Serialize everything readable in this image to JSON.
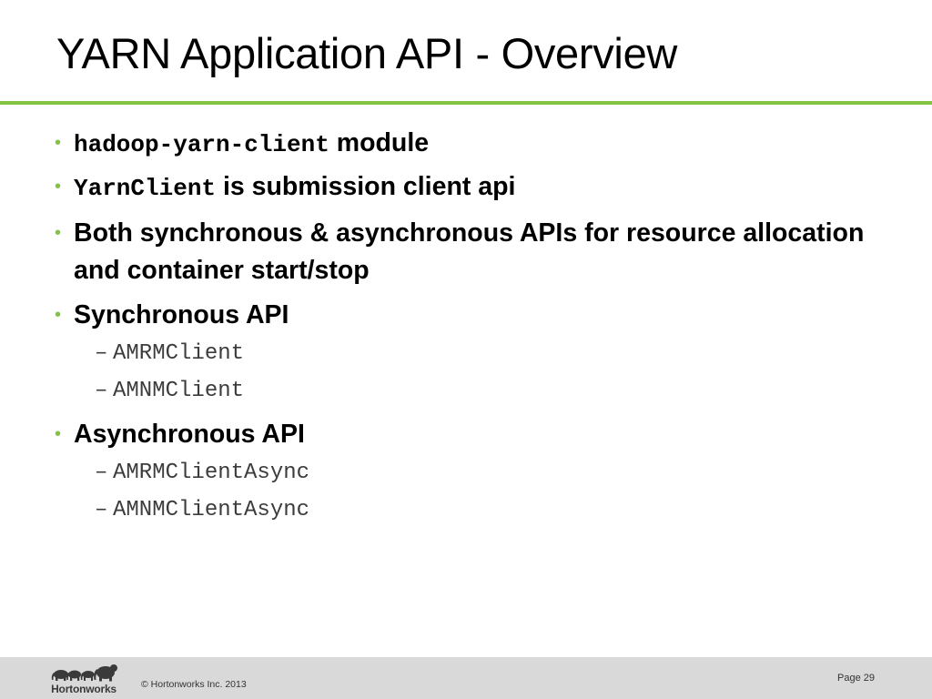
{
  "slide": {
    "title": "YARN Application API - Overview"
  },
  "bullets": [
    {
      "code": "hadoop-yarn-client",
      "text": " module"
    },
    {
      "code": "YarnClient",
      "text": " is submission client api"
    },
    {
      "text": "Both synchronous & asynchronous APIs for resource allocation and container start/stop"
    },
    {
      "text": "Synchronous API",
      "subitems": [
        "AMRMClient",
        "AMNMClient"
      ]
    },
    {
      "text": "Asynchronous API",
      "subitems": [
        "AMRMClientAsync",
        "AMNMClientAsync"
      ]
    }
  ],
  "bullet_marker": "•",
  "sub_marker": "–",
  "footer": {
    "logo_text": "Hortonworks",
    "copyright": "© Hortonworks Inc. 2013",
    "page": "Page 29"
  },
  "colors": {
    "accent": "#82c341",
    "footer_bg": "#d9d9d9"
  }
}
